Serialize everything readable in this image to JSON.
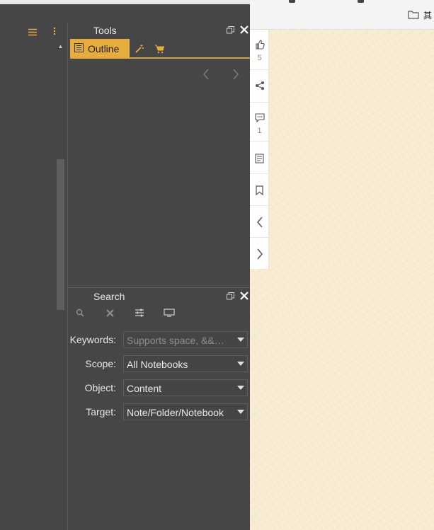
{
  "app": {
    "left_menu_icon": "hamburger-icon",
    "left_more_icon": "more-vertical-icon"
  },
  "tools_panel": {
    "title": "Tools",
    "tabs": [
      {
        "label": "Outline",
        "icon": "outline-icon",
        "active": true
      },
      {
        "icon": "magic-wand-icon"
      },
      {
        "icon": "cart-icon"
      }
    ],
    "prev_icon": "chevron-left-icon",
    "next_icon": "chevron-right-icon"
  },
  "search_panel": {
    "title": "Search",
    "tool_icons": [
      "search-icon",
      "close-icon",
      "sliders-icon",
      "monitor-icon"
    ],
    "fields": [
      {
        "label": "Keywords:",
        "value": "",
        "placeholder": "Supports space, &&…"
      },
      {
        "label": "Scope:",
        "value": "All Notebooks"
      },
      {
        "label": "Object:",
        "value": "Content"
      },
      {
        "label": "Target:",
        "value": "Note/Folder/Notebook"
      }
    ]
  },
  "page_side": {
    "like_count": "5",
    "comment_count": "1"
  },
  "bookmark": {
    "label": "其"
  },
  "colors": {
    "accent": "#e7ac3e",
    "panel_bg": "#464646",
    "paper": "#f7ebd0"
  }
}
